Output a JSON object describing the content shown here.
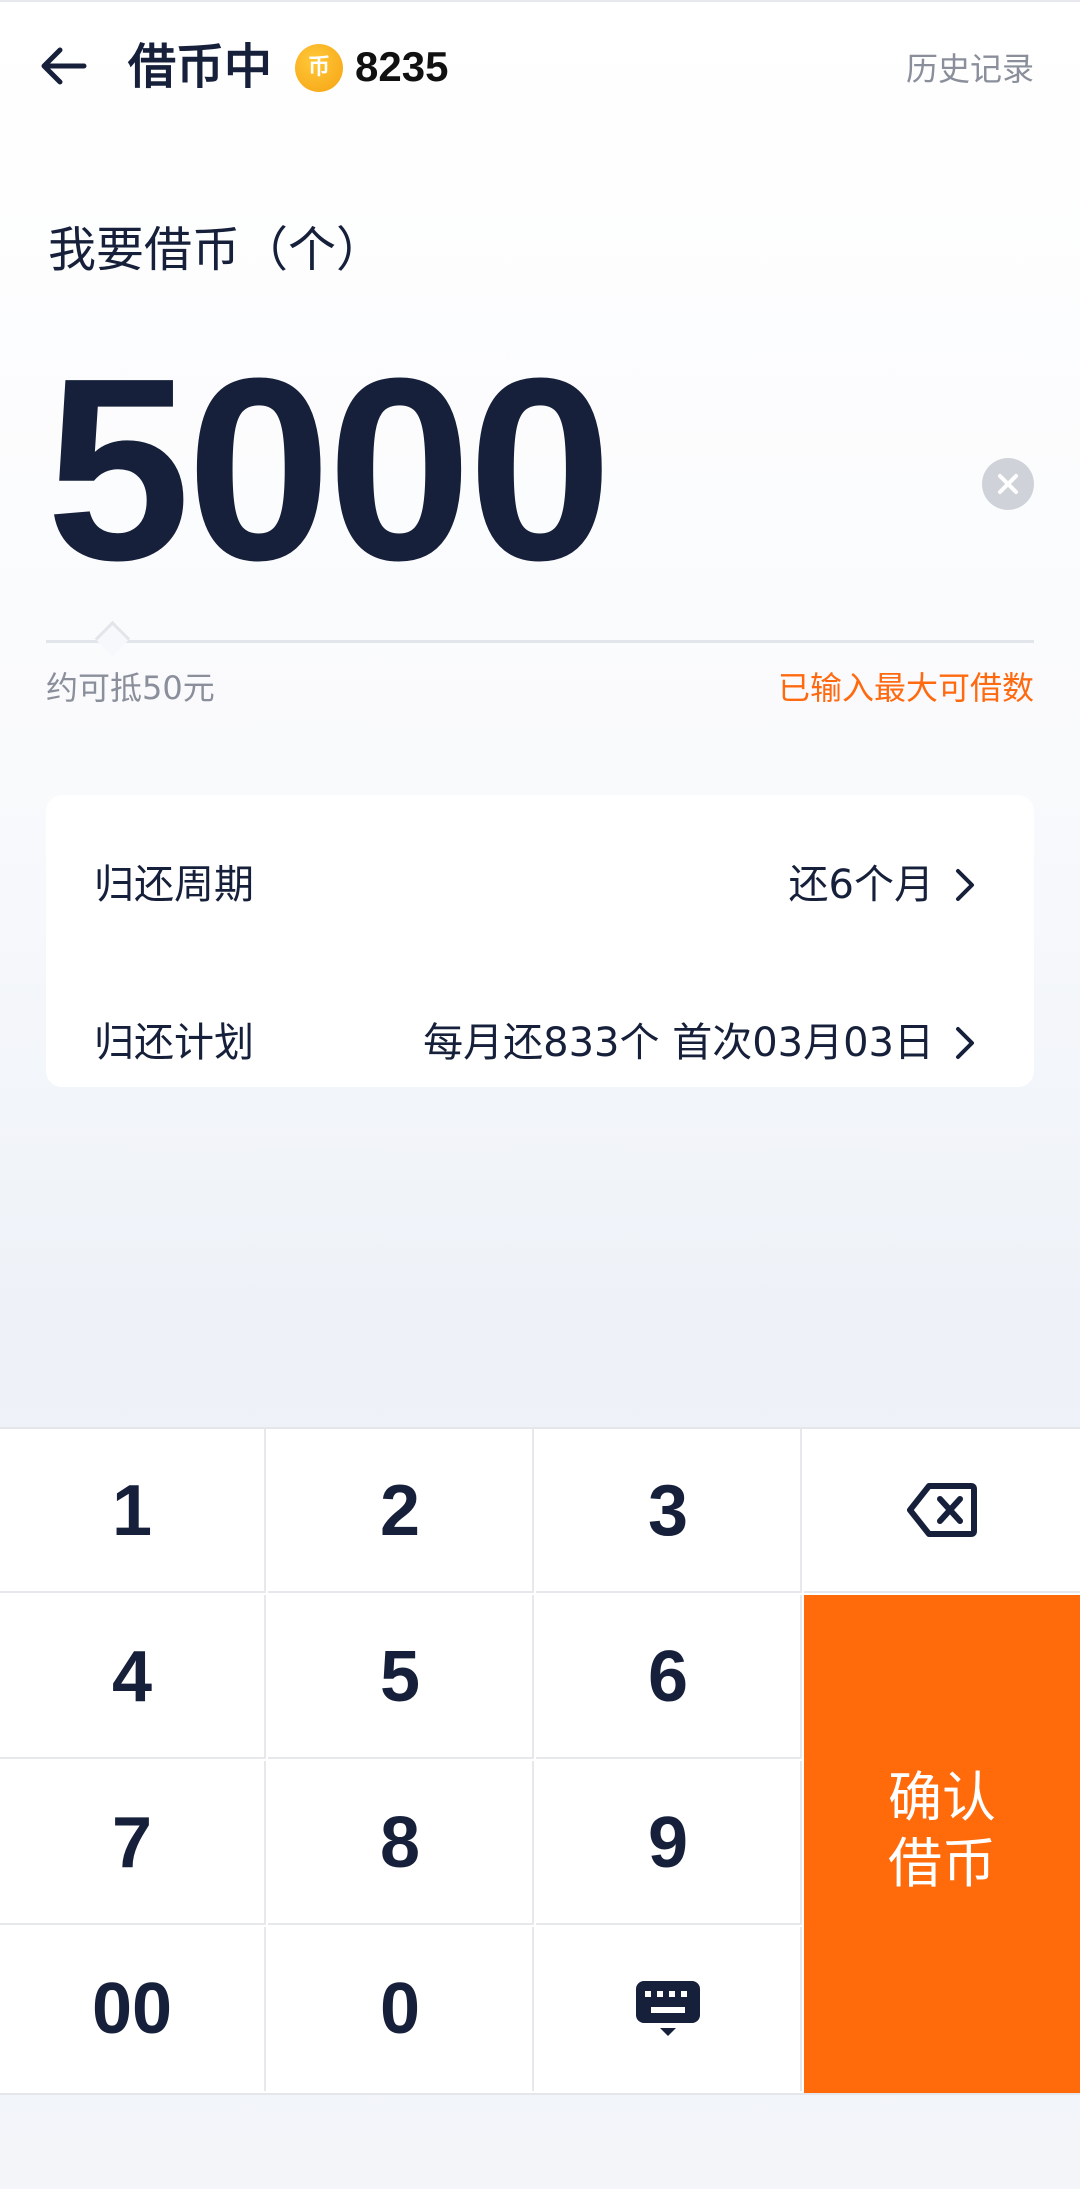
{
  "header": {
    "title": "借币中",
    "coin_symbol": "币",
    "coin_balance": "8235",
    "history_label": "历史记录",
    "coin_color": "#f6a312"
  },
  "borrow": {
    "label": "我要借币（个）",
    "amount": "5000",
    "equivalent_hint": "约可抵50元",
    "max_hint": "已输入最大可借数"
  },
  "details": {
    "period_label": "归还周期",
    "period_value": "还6个月",
    "plan_label": "归还计划",
    "plan_value": "每月还833个 首次03月03日"
  },
  "keypad": {
    "keys": [
      "1",
      "2",
      "3",
      "4",
      "5",
      "6",
      "7",
      "8",
      "9",
      "00",
      "0"
    ],
    "confirm_line1": "确认",
    "confirm_line2": "借币",
    "accent_color": "#ff6a0a"
  }
}
